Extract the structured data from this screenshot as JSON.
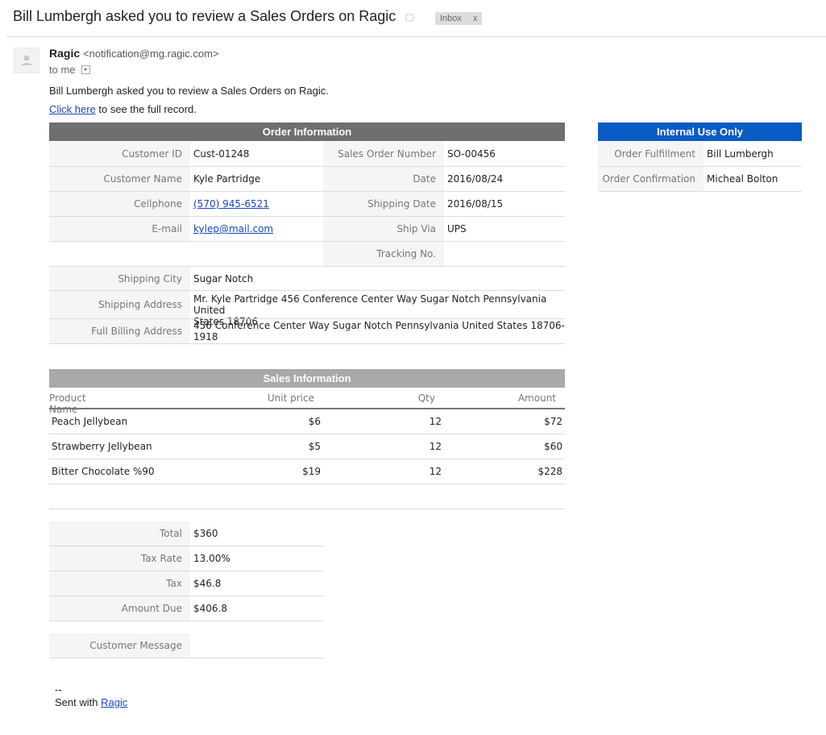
{
  "email": {
    "subject": "Bill Lumbergh asked you to review a Sales Orders on Ragic",
    "inbox_label": "Inbox",
    "inbox_remove": "x",
    "sender_name": "Ragic",
    "sender_email": "<notification@mg.ragic.com>",
    "to_label": "to me",
    "intro": "Bill Lumbergh asked you to review a Sales Orders on Ragic.",
    "link_text": "Click here",
    "link_suffix": " to see the full record.",
    "sig_dash": "--",
    "sig_prefix": "Sent with ",
    "sig_link": "Ragic"
  },
  "order": {
    "title": "Order Information",
    "customer_id_label": "Customer ID",
    "customer_id": "Cust-01248",
    "customer_name_label": "Customer Name",
    "customer_name": "Kyle Partridge",
    "cellphone_label": "Cellphone",
    "cellphone": "(570) 945-6521",
    "email_label": "E-mail",
    "email": "kylep@mail.com",
    "so_number_label": "Sales Order Number",
    "so_number": "SO-00456",
    "date_label": "Date",
    "date": "2016/08/24",
    "shipping_date_label": "Shipping Date",
    "shipping_date": "2016/08/15",
    "ship_via_label": "Ship Via",
    "ship_via": "UPS",
    "tracking_label": "Tracking No.",
    "tracking": "",
    "shipping_city_label": "Shipping City",
    "shipping_city": "Sugar Notch",
    "shipping_address_label": "Shipping Address",
    "shipping_address_1": "Mr.  Kyle Partridge 456 Conference Center Way Sugar Notch Pennsylvania United",
    "shipping_address_2": "States 18706",
    "billing_address_label": "Full Billing Address",
    "billing_address": "456 Conference Center Way Sugar Notch Pennsylvania United States 18706-1918"
  },
  "internal": {
    "title": "Internal Use Only",
    "fulfillment_label": "Order Fulfillment",
    "fulfillment": "Bill Lumbergh",
    "confirmation_label": "Order Confirmation",
    "confirmation": "Micheal Bolton"
  },
  "sales": {
    "title": "Sales Information",
    "col_product": "Product Name",
    "col_price": "Unit price",
    "col_qty": "Qty",
    "col_amount": "Amount",
    "rows": [
      {
        "product": "Peach Jellybean",
        "price": "$6",
        "qty": "12",
        "amount": "$72"
      },
      {
        "product": "Strawberry Jellybean",
        "price": "$5",
        "qty": "12",
        "amount": "$60"
      },
      {
        "product": "Bitter Chocolate %90",
        "price": "$19",
        "qty": "12",
        "amount": "$228"
      }
    ]
  },
  "totals": {
    "total_label": "Total",
    "total": "$360",
    "tax_rate_label": "Tax Rate",
    "tax_rate": "13.00%",
    "tax_label": "Tax",
    "tax": "$46.8",
    "due_label": "Amount Due",
    "due": "$406.8",
    "message_label": "Customer Message",
    "message": ""
  },
  "colors": {
    "order_head": "#6f6f6f",
    "internal_head": "#0a5bc4",
    "sales_head": "#a9a9a9",
    "link": "#1a47c2"
  }
}
